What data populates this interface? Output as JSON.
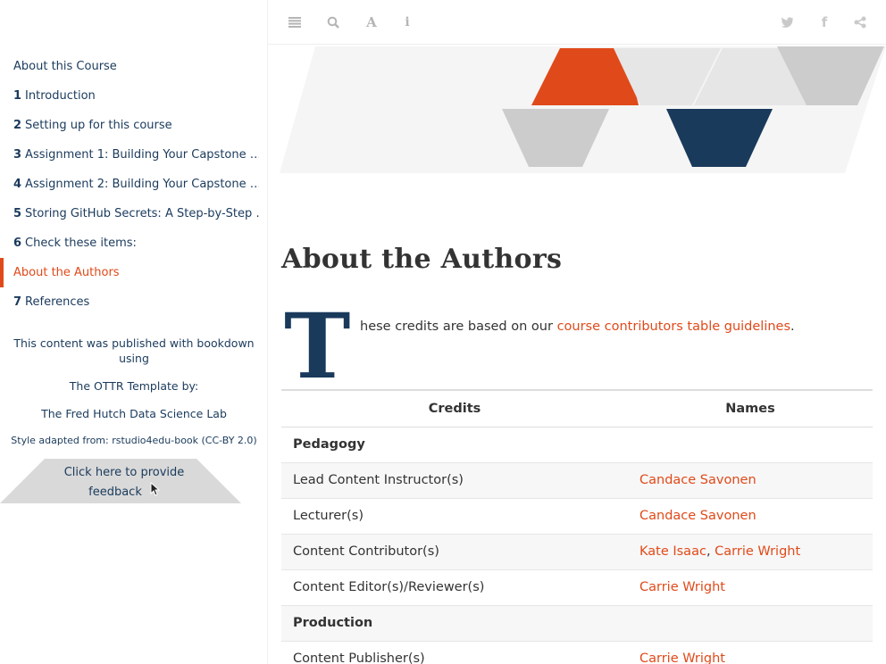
{
  "sidebar": {
    "items": [
      {
        "num": "",
        "label": "About this Course",
        "active": false
      },
      {
        "num": "1",
        "label": "Introduction",
        "active": false
      },
      {
        "num": "2",
        "label": "Setting up for this course",
        "active": false
      },
      {
        "num": "3",
        "label": "Assignment 1: Building Your Capstone …",
        "active": false
      },
      {
        "num": "4",
        "label": "Assignment 2: Building Your Capstone …",
        "active": false
      },
      {
        "num": "5",
        "label": "Storing GitHub Secrets: A Step-by-Step …",
        "active": false
      },
      {
        "num": "6",
        "label": "Check these items:",
        "active": false
      },
      {
        "num": "",
        "label": "About the Authors",
        "active": true
      },
      {
        "num": "7",
        "label": "References",
        "active": false
      }
    ],
    "published_line1": "This content was published with bookdown",
    "published_line2": "using",
    "template_by": "The OTTR Template by:",
    "lab": "The Fred Hutch Data Science Lab",
    "style_adapted": "Style adapted from: rstudio4edu-book (CC-BY 2.0)",
    "feedback_line1": "Click here to provide",
    "feedback_line2": "feedback"
  },
  "toolbar": {
    "left_icons": [
      "menu-icon",
      "search-icon",
      "font-icon",
      "info-icon"
    ],
    "right_icons": [
      "twitter-icon",
      "facebook-icon",
      "share-icon"
    ]
  },
  "colors": {
    "accent": "#e04a1a",
    "navy": "#1a3a5c",
    "gray": "#cccccc"
  },
  "main": {
    "title": "About the Authors",
    "dropcap": "T",
    "intro_text": "hese credits are based on our ",
    "intro_link": "course contributors table guidelines",
    "intro_end": "."
  },
  "table": {
    "headers": [
      "Credits",
      "Names"
    ],
    "rows": [
      {
        "credit": "Pedagogy",
        "names": [],
        "section": true
      },
      {
        "credit": "Lead Content Instructor(s)",
        "names": [
          "Candace Savonen"
        ],
        "section": false
      },
      {
        "credit": "Lecturer(s)",
        "names": [
          "Candace Savonen"
        ],
        "section": false
      },
      {
        "credit": "Content Contributor(s)",
        "names": [
          "Kate Isaac",
          "Carrie Wright"
        ],
        "section": false
      },
      {
        "credit": "Content Editor(s)/Reviewer(s)",
        "names": [
          "Carrie Wright"
        ],
        "section": false
      },
      {
        "credit": "Production",
        "names": [],
        "section": true
      },
      {
        "credit": "Content Publisher(s)",
        "names": [
          "Carrie Wright"
        ],
        "section": false
      }
    ]
  }
}
